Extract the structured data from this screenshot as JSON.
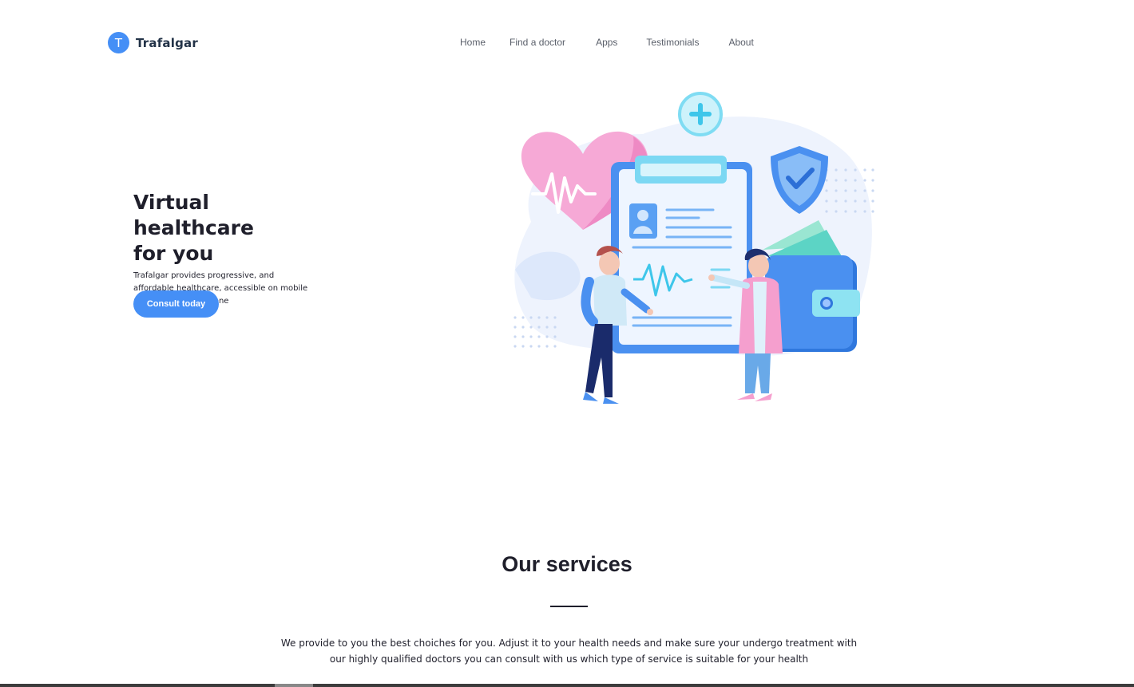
{
  "header": {
    "logo_letter": "T",
    "brand": "Trafalgar",
    "nav": [
      "Home",
      "Find a doctor",
      "Apps",
      "Testimonials",
      "About"
    ]
  },
  "hero": {
    "title_line1": "Virtual healthcare",
    "title_line2": "for you",
    "subtitle": "Trafalgar provides progressive, and affordable healthcare, accessible on mobile and online for everyone",
    "cta": "Consult today"
  },
  "services": {
    "title": "Our services",
    "description_line1": "We provide to you the best choiches for you. Adjust it to your health needs and make sure your undergo treatment with",
    "description_line2": "our highly qualified doctors you can consult with us which type of service is suitable for your health"
  },
  "colors": {
    "accent": "#458ff6",
    "text": "#1f1f2b"
  }
}
